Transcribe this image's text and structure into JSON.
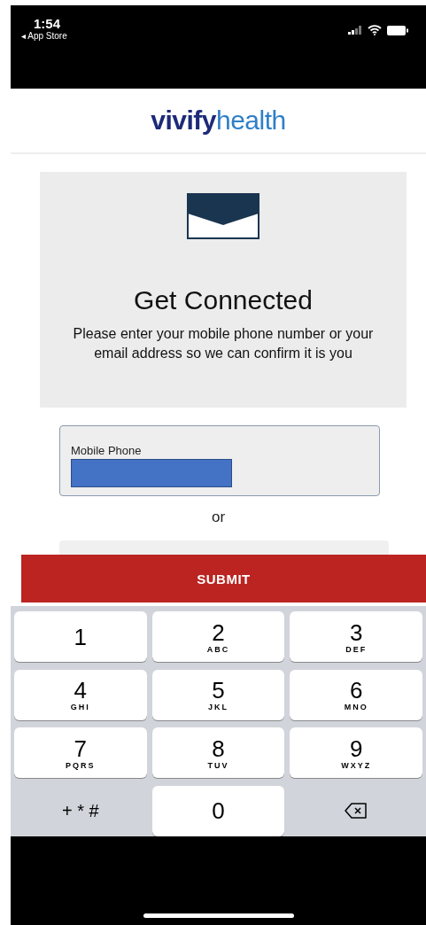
{
  "status_bar": {
    "time": "1:54",
    "back_label": "◂ App Store"
  },
  "logo": {
    "lead": "vivify",
    "tail": "health"
  },
  "card": {
    "title": "Get Connected",
    "message": "Please enter your mobile phone number or your email address so we can confirm it is you"
  },
  "fields": [
    {
      "kind": "phone",
      "label": "Mobile Phone",
      "redacted": true
    },
    {
      "kind": "partial"
    }
  ],
  "separator": "or",
  "submit_button": "SUBMIT",
  "keypad": [
    {
      "kind": "digit",
      "digit": "1"
    },
    {
      "kind": "digit",
      "digit": "2",
      "letters": "ABC"
    },
    {
      "kind": "digit",
      "digit": "3",
      "letters": "DEF"
    },
    {
      "kind": "digit",
      "digit": "4",
      "letters": "GHI"
    },
    {
      "kind": "digit",
      "digit": "5",
      "letters": "JKL"
    },
    {
      "kind": "digit",
      "digit": "6",
      "letters": "MNO"
    },
    {
      "kind": "digit",
      "digit": "7",
      "letters": "PQRS"
    },
    {
      "kind": "digit",
      "digit": "8",
      "letters": "TUV"
    },
    {
      "kind": "digit",
      "digit": "9",
      "letters": "WXYZ"
    },
    {
      "kind": "symbols",
      "digit": "+ * #"
    },
    {
      "kind": "digit",
      "digit": "0"
    },
    {
      "kind": "delete"
    }
  ]
}
